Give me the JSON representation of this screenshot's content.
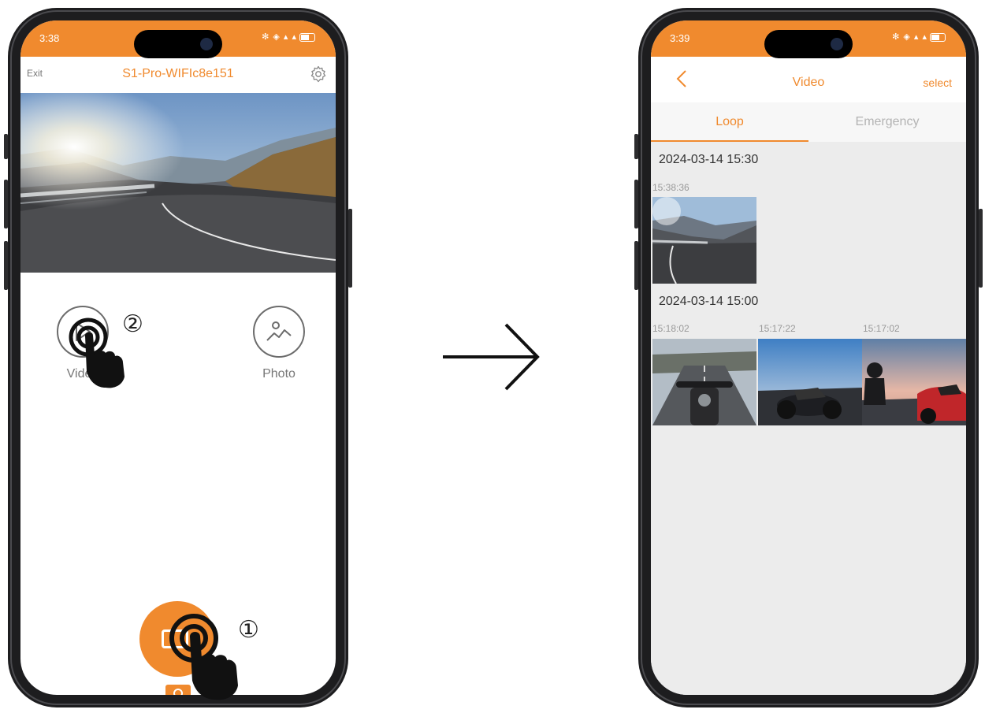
{
  "left_screen": {
    "status_time": "3:38",
    "exit_label": "Exit",
    "device_name": "S1-Pro-WIFIc8e151",
    "menu": {
      "video_label": "Video",
      "photo_label": "Photo"
    },
    "steps": {
      "first": "①",
      "second": "②"
    }
  },
  "right_screen": {
    "status_time": "3:39",
    "title": "Video",
    "select_label": "select",
    "tabs": {
      "loop": "Loop",
      "emergency": "Emergency"
    },
    "groups": [
      {
        "date": "2024-03-14 15:30",
        "clips": [
          {
            "time": "15:38:36"
          }
        ]
      },
      {
        "date": "2024-03-14 15:00",
        "clips": [
          {
            "time": "15:18:02"
          },
          {
            "time": "15:17:22"
          },
          {
            "time": "15:17:02"
          }
        ]
      }
    ]
  },
  "colors": {
    "accent": "#f08a2e",
    "frame": "#1d1d1f",
    "list_background": "#ececec"
  },
  "icons": [
    "settings-gear-icon",
    "play-icon",
    "image-icon",
    "camera-icon",
    "back-chevron-icon",
    "tap-hand-icon",
    "arrow-right-icon"
  ]
}
